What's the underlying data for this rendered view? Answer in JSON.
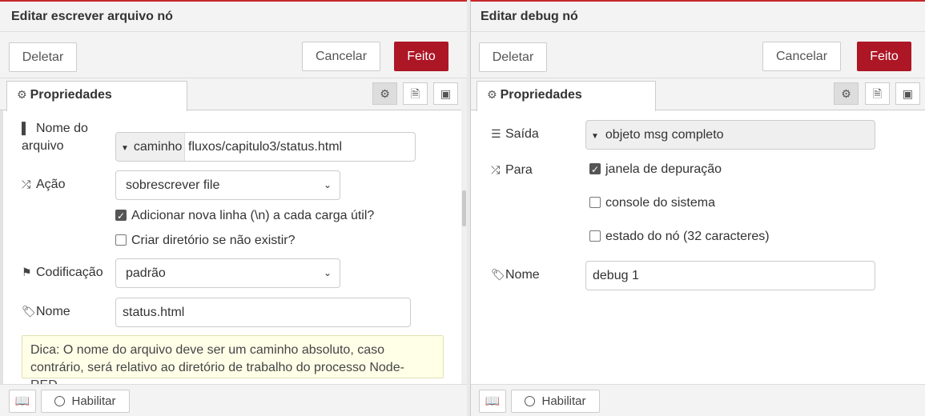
{
  "left": {
    "title": "Editar escrever arquivo nó",
    "delete_label": "Deletar",
    "cancel_label": "Cancelar",
    "done_label": "Feito",
    "tab_label": "Propriedades",
    "filename_label_line1": "Nome do",
    "filename_label_line2": "arquivo",
    "filename_type": "caminho",
    "filename_value": "fluxos/capitulo3/status.html",
    "action_label": "Ação",
    "action_value": "sobrescrever file",
    "append_newline_label": "Adicionar nova linha (\\n) a cada carga útil?",
    "append_newline_checked": true,
    "create_dir_label": "Criar diretório se não existir?",
    "create_dir_checked": false,
    "encoding_label": "Codificação",
    "encoding_value": "padrão",
    "name_label": "Nome",
    "name_value": "status.html",
    "tip_text": "Dica: O nome do arquivo deve ser um caminho absoluto, caso contrário, será relativo ao diretório de trabalho do processo Node-RED.",
    "enable_label": "Habilitar"
  },
  "right": {
    "title": "Editar debug nó",
    "delete_label": "Deletar",
    "cancel_label": "Cancelar",
    "done_label": "Feito",
    "tab_label": "Propriedades",
    "output_label": "Saída",
    "output_value": "objeto msg completo",
    "to_label": "Para",
    "debug_window_label": "janela de depuração",
    "debug_window_checked": true,
    "system_console_label": "console do sistema",
    "system_console_checked": false,
    "node_status_label": "estado do nó (32 caracteres)",
    "node_status_checked": false,
    "name_label": "Nome",
    "name_value": "debug 1",
    "enable_label": "Habilitar"
  },
  "icons": {
    "tab": "gear-icon",
    "tab_buttons": [
      "gear-icon",
      "document-icon",
      "layout-icon"
    ],
    "filename": "file-icon",
    "action": "shuffle-icon",
    "encoding": "flag-icon",
    "name": "tag-icon",
    "output": "list-icon",
    "to": "shuffle-icon",
    "footer_book": "book-icon"
  },
  "colors": {
    "accent": "#ad1625",
    "top_border": "#c62828",
    "tip_bg": "#ffffe8"
  }
}
